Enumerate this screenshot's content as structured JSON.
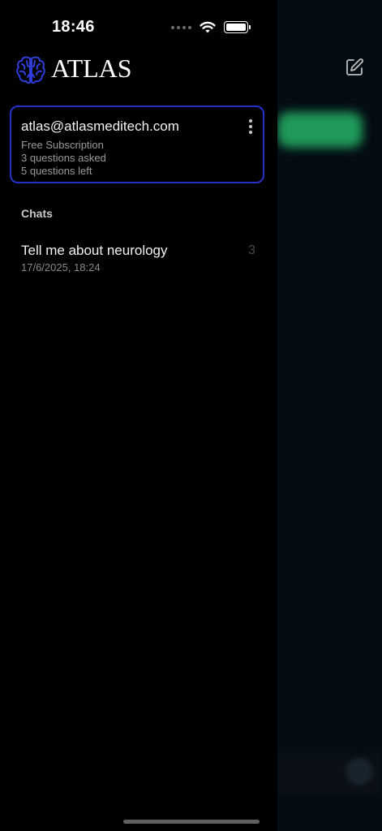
{
  "status_bar": {
    "time": "18:46"
  },
  "app": {
    "brand": "ATLAS",
    "logo_icon": "brain-icon",
    "compose_icon": "compose-icon"
  },
  "account": {
    "email": "atlas@atlasmeditech.com",
    "plan": "Free Subscription",
    "asked": "3 questions asked",
    "left": "5 questions left"
  },
  "chats": {
    "section_title": "Chats",
    "items": [
      {
        "title": "Tell me about neurology",
        "date": "17/6/2025, 18:24",
        "count": "3"
      }
    ]
  },
  "colors": {
    "card_border": "#2531c9",
    "accent_green": "#1f9a5b",
    "brand_blue": "#2f3ed8"
  }
}
